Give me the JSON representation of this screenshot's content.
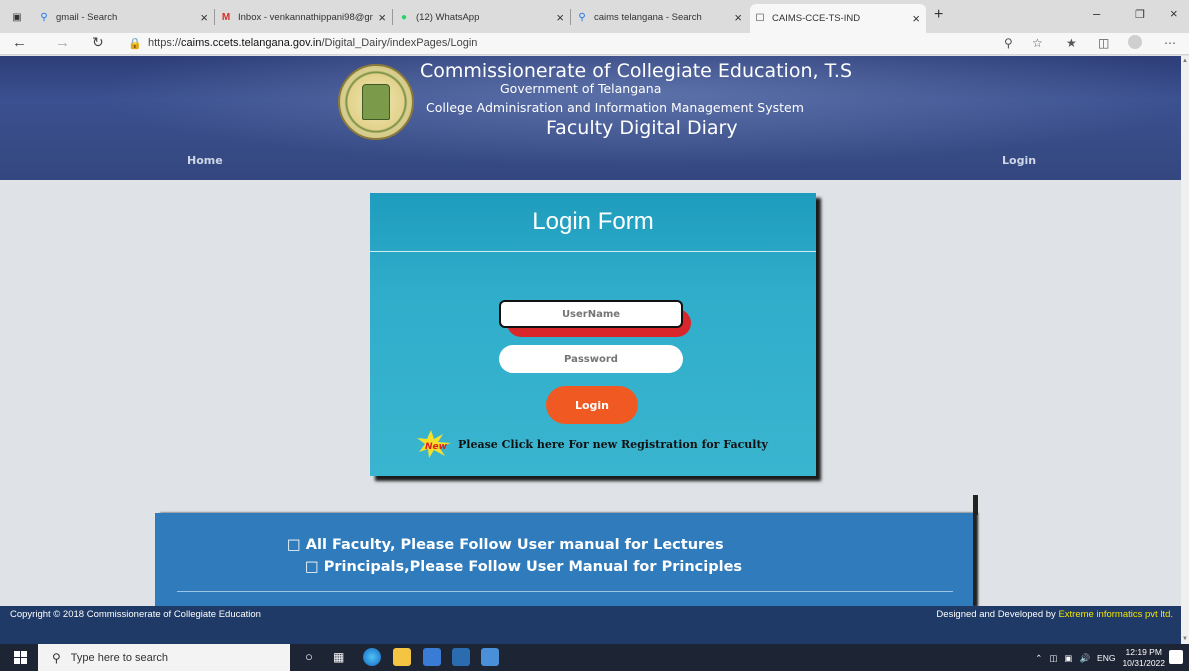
{
  "browser": {
    "tabs": [
      {
        "label": "gmail - Search",
        "icon": "search-icon"
      },
      {
        "label": "Inbox - venkannathippani98@gr",
        "icon": "gmail-icon"
      },
      {
        "label": "(12) WhatsApp",
        "icon": "whatsapp-icon"
      },
      {
        "label": "caims telangana - Search",
        "icon": "search-icon"
      },
      {
        "label": "CAIMS-CCE-TS-IND",
        "icon": "page-icon"
      }
    ],
    "url_prefix": "https://",
    "url_domain": "caims.ccets.telangana.gov.in",
    "url_path": "/Digital_Dairy/indexPages/Login"
  },
  "header": {
    "line1": "Commissionerate of Collegiate Education, T.S",
    "line2": "Government of Telangana",
    "line3": "College Adminisration and Information Management System",
    "line4": "Faculty Digital Diary",
    "nav_home": "Home",
    "nav_login": "Login"
  },
  "login": {
    "title": "Login Form",
    "username_placeholder": "UserName",
    "password_placeholder": "Password",
    "button": "Login",
    "new_badge": "New",
    "registration_link": "Please Click here For new Registration for Faculty"
  },
  "notice": {
    "items": [
      "□ All Faculty, Please Follow User manual for Lectures",
      "□ Principals,Please Follow User Manual for Principles"
    ]
  },
  "footer": {
    "copyright": "Copyright © 2018 Commissionerate of Collegiate Education",
    "designed_prefix": "Designed and Developed by ",
    "designed_company": "Extreme informatics pvt ltd."
  },
  "taskbar": {
    "search_placeholder": "Type here to search",
    "language": "ENG",
    "time": "12:19 PM",
    "date": "10/31/2022"
  },
  "colors": {
    "header_bg": "#34477f",
    "login_bg": "#2fadca",
    "login_button": "#f05a22",
    "notice_bg": "#2f7bbc",
    "footer_bg": "#1f3a66",
    "footer_link": "#f2e600"
  }
}
